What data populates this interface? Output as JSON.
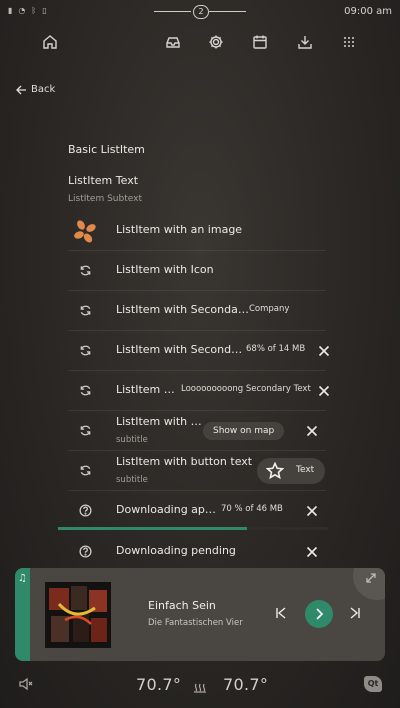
{
  "status_bar": {
    "page_indicator": "2",
    "time": "09:00 am"
  },
  "nav": {
    "icons": [
      "home-icon",
      "inbox-icon",
      "settings-icon",
      "calendar-icon",
      "download-icon",
      "apps-grid-icon"
    ]
  },
  "back_label": "Back",
  "list": {
    "section_title": "Basic ListItem",
    "text_item": {
      "title": "ListItem Text",
      "subtitle": "ListItem Subtext"
    },
    "items": [
      {
        "label": "ListItem with an image"
      },
      {
        "label": "ListItem with Icon"
      },
      {
        "label": "ListItem with Seconda…",
        "secondary": "Company"
      },
      {
        "label": "ListItem with Second…",
        "secondary": "68% of 14 MB"
      },
      {
        "label": "ListItem …",
        "secondary": "Looooooooong Secondary Text"
      },
      {
        "label": "ListItem with …",
        "subtitle": "subtitle",
        "button": "Show on map"
      },
      {
        "label": "ListItem with button text",
        "subtitle": "subtitle",
        "button": "Text"
      },
      {
        "label": "Downloading ap…",
        "secondary": "70 % of 46 MB",
        "progress": 0.7
      },
      {
        "label": "Downloading pending"
      }
    ]
  },
  "media": {
    "title": "Einfach Sein",
    "artist": "Die Fantastischen Vier",
    "accent": "#2f8a6b"
  },
  "climate": {
    "left_temp": "70.7°",
    "right_temp": "70.7°"
  },
  "brand": "Qt"
}
